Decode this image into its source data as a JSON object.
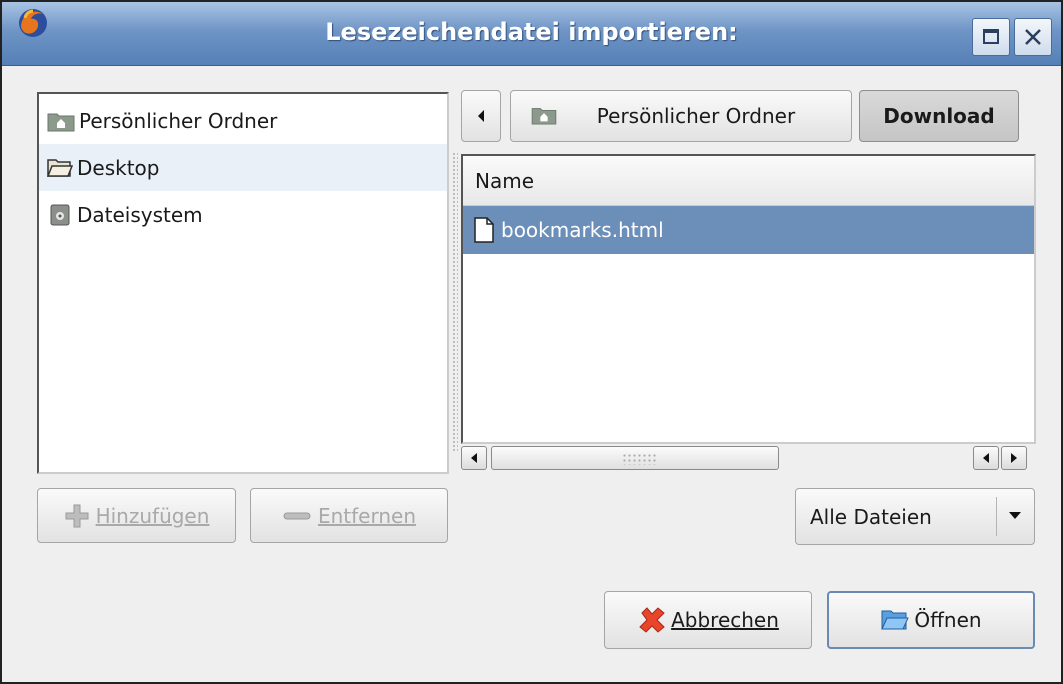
{
  "window": {
    "title": "Lesezeichendatei importieren:"
  },
  "places": {
    "items": [
      {
        "label": "Persönlicher Ordner",
        "icon": "home-folder-icon"
      },
      {
        "label": "Desktop",
        "icon": "folder-open-icon",
        "selected": true
      },
      {
        "label": "Dateisystem",
        "icon": "drive-icon"
      }
    ],
    "add_label": "Hinzufügen",
    "remove_label": "Entfernen"
  },
  "path_bar": {
    "items": [
      {
        "label": "Persönlicher Ordner"
      },
      {
        "label": "Download",
        "active": true
      }
    ]
  },
  "file_list": {
    "column": "Name",
    "files": [
      {
        "name": "bookmarks.html",
        "selected": true
      }
    ]
  },
  "filter": {
    "selected": "Alle Dateien"
  },
  "actions": {
    "cancel_label": "Abbrechen",
    "open_label": "Öffnen"
  },
  "colors": {
    "selection": "#6b8fb9",
    "titlebar": "#6f95c6"
  }
}
